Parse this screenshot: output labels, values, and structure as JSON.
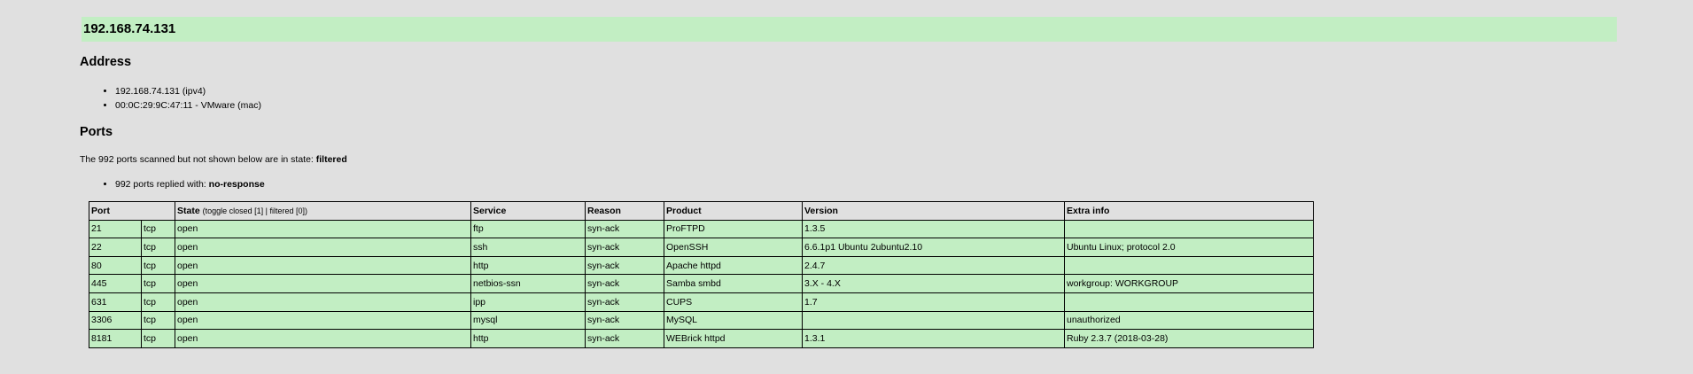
{
  "host": {
    "title": "192.168.74.131"
  },
  "address": {
    "heading": "Address",
    "items": [
      "192.168.74.131 (ipv4)",
      "00:0C:29:9C:47:11 - VMware (mac)"
    ]
  },
  "ports": {
    "heading": "Ports",
    "filtered_note_prefix": "The 992 ports scanned but not shown below are in state: ",
    "filtered_note_state": "filtered",
    "replied_prefix": "992 ports replied with: ",
    "replied_reason": "no-response",
    "columns": {
      "port": "Port",
      "state": "State",
      "toggle_open": "(",
      "toggle_closed": "toggle closed [1]",
      "toggle_sep": " | ",
      "toggle_filtered": "filtered [0]",
      "toggle_close": ")",
      "service": "Service",
      "reason": "Reason",
      "product": "Product",
      "version": "Version",
      "extra": "Extra info"
    },
    "rows": [
      {
        "port": "21",
        "proto": "tcp",
        "state": "open",
        "service": "ftp",
        "reason": "syn-ack",
        "product": "ProFTPD",
        "version": "1.3.5",
        "extra": ""
      },
      {
        "port": "22",
        "proto": "tcp",
        "state": "open",
        "service": "ssh",
        "reason": "syn-ack",
        "product": "OpenSSH",
        "version": "6.6.1p1 Ubuntu 2ubuntu2.10",
        "extra": "Ubuntu Linux; protocol 2.0"
      },
      {
        "port": "80",
        "proto": "tcp",
        "state": "open",
        "service": "http",
        "reason": "syn-ack",
        "product": "Apache httpd",
        "version": "2.4.7",
        "extra": ""
      },
      {
        "port": "445",
        "proto": "tcp",
        "state": "open",
        "service": "netbios-ssn",
        "reason": "syn-ack",
        "product": "Samba smbd",
        "version": "3.X - 4.X",
        "extra": "workgroup: WORKGROUP"
      },
      {
        "port": "631",
        "proto": "tcp",
        "state": "open",
        "service": "ipp",
        "reason": "syn-ack",
        "product": "CUPS",
        "version": "1.7",
        "extra": ""
      },
      {
        "port": "3306",
        "proto": "tcp",
        "state": "open",
        "service": "mysql",
        "reason": "syn-ack",
        "product": "MySQL",
        "version": "",
        "extra": "unauthorized"
      },
      {
        "port": "8181",
        "proto": "tcp",
        "state": "open",
        "service": "http",
        "reason": "syn-ack",
        "product": "WEBrick httpd",
        "version": "1.3.1",
        "extra": "Ruby 2.3.7 (2018-03-28)"
      }
    ]
  },
  "colors": {
    "background": "#e0e0e0",
    "highlight": "#c2eec3"
  }
}
